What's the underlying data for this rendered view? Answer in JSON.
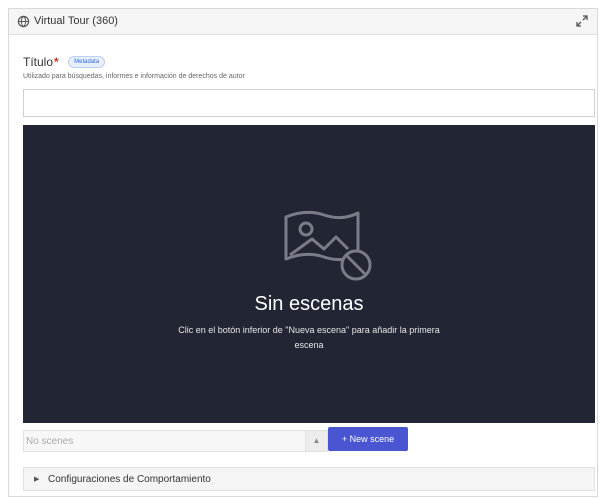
{
  "header": {
    "title": "Virtual Tour (360)",
    "icon": "globe-icon",
    "expand_icon": "expand-icon"
  },
  "field": {
    "label": "Título",
    "required_mark": "*",
    "badge": "Metadata",
    "helper": "Utilizado para búsquedas, informes e información de derechos de autor",
    "value": ""
  },
  "viewer": {
    "icon": "no-image-icon",
    "empty_title": "Sin escenas",
    "empty_desc": "Clic en el botón inferior de \"Nueva escena\" para añadir la primera escena",
    "background": "#222533"
  },
  "scenes": {
    "select_placeholder": "No scenes",
    "new_scene_label": "+ New scene",
    "accent": "#4a56d1"
  },
  "section": {
    "label": "Configuraciones de Comportamiento"
  }
}
